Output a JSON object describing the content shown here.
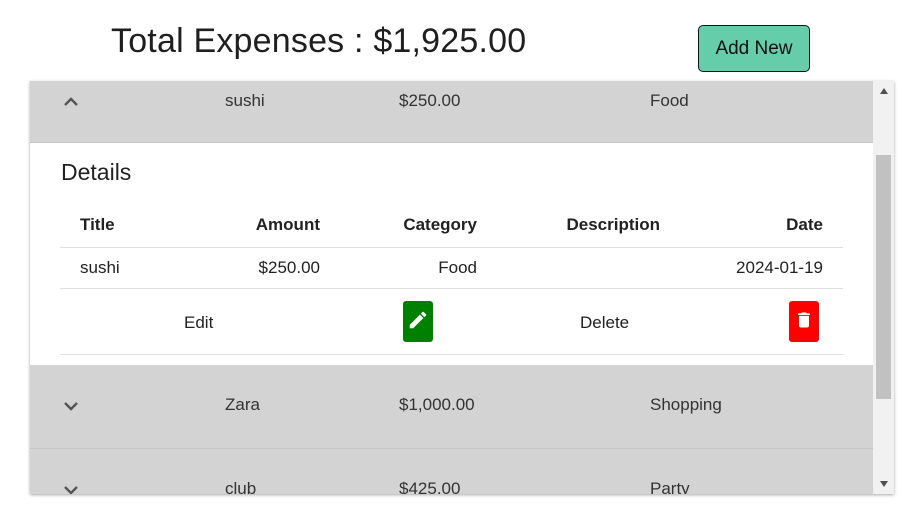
{
  "header": {
    "title": "Total Expenses : $1,925.00",
    "add_button_label": "Add New",
    "add_button_color": "#66cdaa"
  },
  "expenses": [
    {
      "title": "sushi",
      "amount": "$250.00",
      "category": "Food",
      "expanded": true,
      "toggle_icon": "chevron-up-icon"
    },
    {
      "title": "Zara",
      "amount": "$1,000.00",
      "category": "Shopping",
      "expanded": false,
      "toggle_icon": "chevron-down-icon"
    },
    {
      "title": "club",
      "amount": "$425.00",
      "category": "Party",
      "expanded": false,
      "toggle_icon": "chevron-down-icon"
    }
  ],
  "details": {
    "heading": "Details",
    "columns": [
      "Title",
      "Amount",
      "Category",
      "Description",
      "Date"
    ],
    "row": {
      "title": "sushi",
      "amount": "$250.00",
      "category": "Food",
      "description": "",
      "date": "2024-01-19"
    },
    "edit_label": "Edit",
    "delete_label": "Delete",
    "edit_icon": "pencil-icon",
    "delete_icon": "trash-icon",
    "edit_color": "#008000",
    "delete_color": "#ff0000"
  },
  "colors": {
    "row_background": "#d3d3d3",
    "scrollbar_thumb": "#c1c1c1"
  }
}
